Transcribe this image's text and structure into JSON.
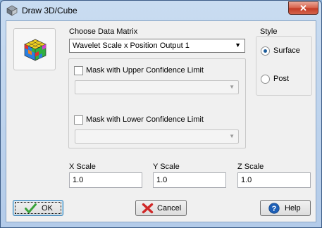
{
  "window": {
    "title": "Draw 3D/Cube",
    "close_glyph": "✕"
  },
  "data_matrix": {
    "label": "Choose Data Matrix",
    "selected": "Wavelet Scale x Position Output 1"
  },
  "mask_upper": {
    "label": "Mask with Upper Confidence Limit",
    "checked": false,
    "value": ""
  },
  "mask_lower": {
    "label": "Mask with Lower Confidence Limit",
    "checked": false,
    "value": ""
  },
  "style": {
    "label": "Style",
    "options": [
      {
        "label": "Surface",
        "selected": true
      },
      {
        "label": "Post",
        "selected": false
      }
    ]
  },
  "scales": {
    "x": {
      "label": "X Scale",
      "value": "1.0"
    },
    "y": {
      "label": "Y Scale",
      "value": "1.0"
    },
    "z": {
      "label": "Z Scale",
      "value": "1.0"
    }
  },
  "buttons": {
    "ok": "OK",
    "cancel": "Cancel",
    "help": "Help"
  },
  "icons": {
    "app": "3d-cube-icon",
    "cube": "rubiks-cube-icon",
    "ok": "checkmark-icon",
    "cancel": "red-x-icon",
    "help": "question-icon"
  }
}
